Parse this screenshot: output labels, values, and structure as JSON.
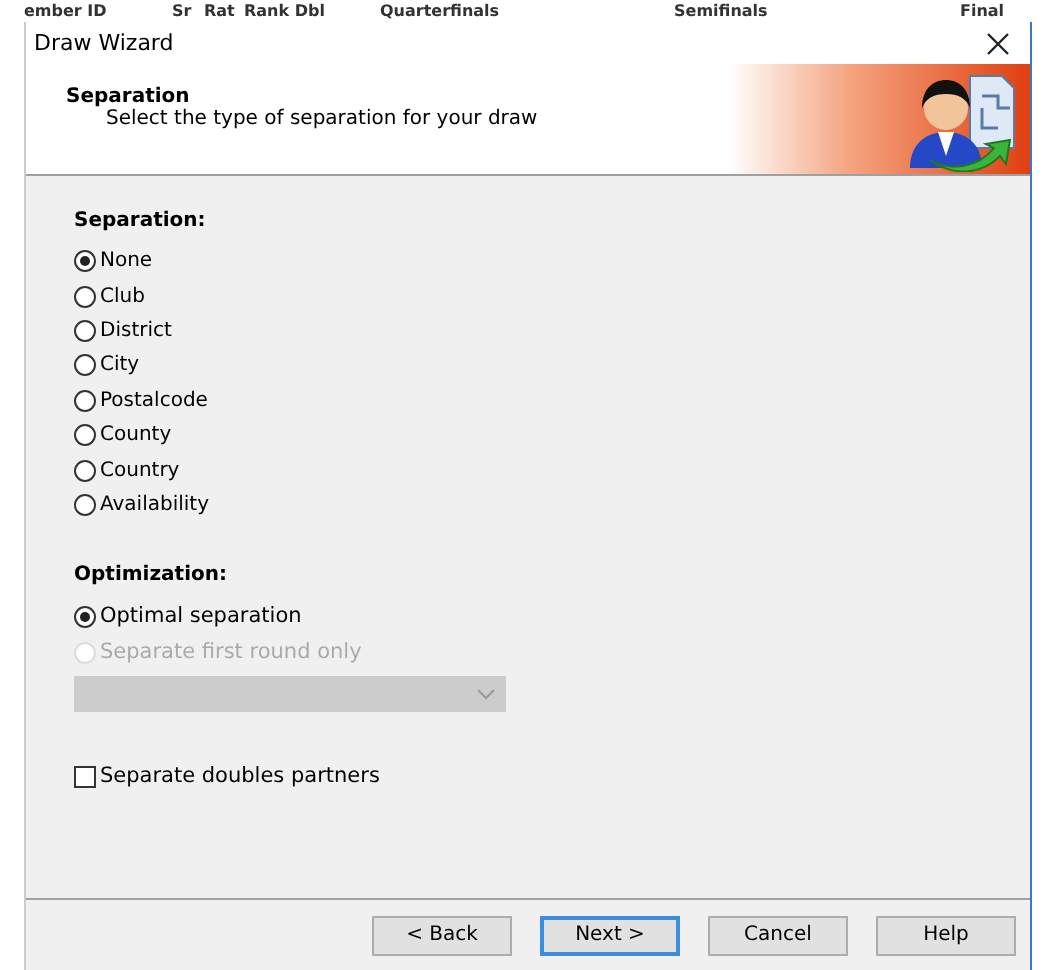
{
  "background_columns": [
    "ember ID",
    "Sr",
    "Rat",
    "Rank Dbl",
    "Quarterfinals",
    "Semifinals",
    "Final"
  ],
  "window": {
    "title": "Draw Wizard"
  },
  "header": {
    "title": "Separation",
    "subtitle": "Select the type of separation for your draw"
  },
  "separation": {
    "label": "Separation:",
    "options": [
      {
        "label": "None",
        "selected": true
      },
      {
        "label": "Club",
        "selected": false
      },
      {
        "label": "District",
        "selected": false
      },
      {
        "label": "City",
        "selected": false
      },
      {
        "label": "Postalcode",
        "selected": false
      },
      {
        "label": "County",
        "selected": false
      },
      {
        "label": "Country",
        "selected": false
      },
      {
        "label": "Availability",
        "selected": false
      }
    ]
  },
  "optimization": {
    "label": "Optimization:",
    "options": [
      {
        "label": "Optimal separation",
        "selected": true,
        "disabled": false
      },
      {
        "label": "Separate first round only",
        "selected": false,
        "disabled": true
      }
    ],
    "dropdown": {
      "disabled": true
    }
  },
  "doubles": {
    "label": "Separate doubles partners",
    "checked": false
  },
  "buttons": [
    {
      "label": "< Back",
      "default": false
    },
    {
      "label": "Next >",
      "default": true
    },
    {
      "label": "Cancel",
      "default": false
    },
    {
      "label": "Help",
      "default": false
    }
  ]
}
